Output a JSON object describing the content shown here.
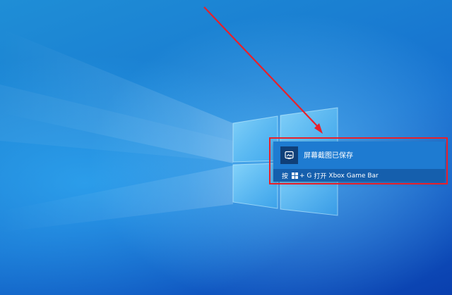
{
  "toast": {
    "title": "屏幕截图已保存",
    "hint_prefix": "按",
    "hint_key_plus": "+ G",
    "hint_action": "打开",
    "hint_app": "Xbox Game Bar",
    "icon": "screenshot-icon",
    "accent": "#1e7bd1"
  },
  "annotation": {
    "highlight_color": "#e8202a",
    "arrow_color": "#e8202a"
  }
}
